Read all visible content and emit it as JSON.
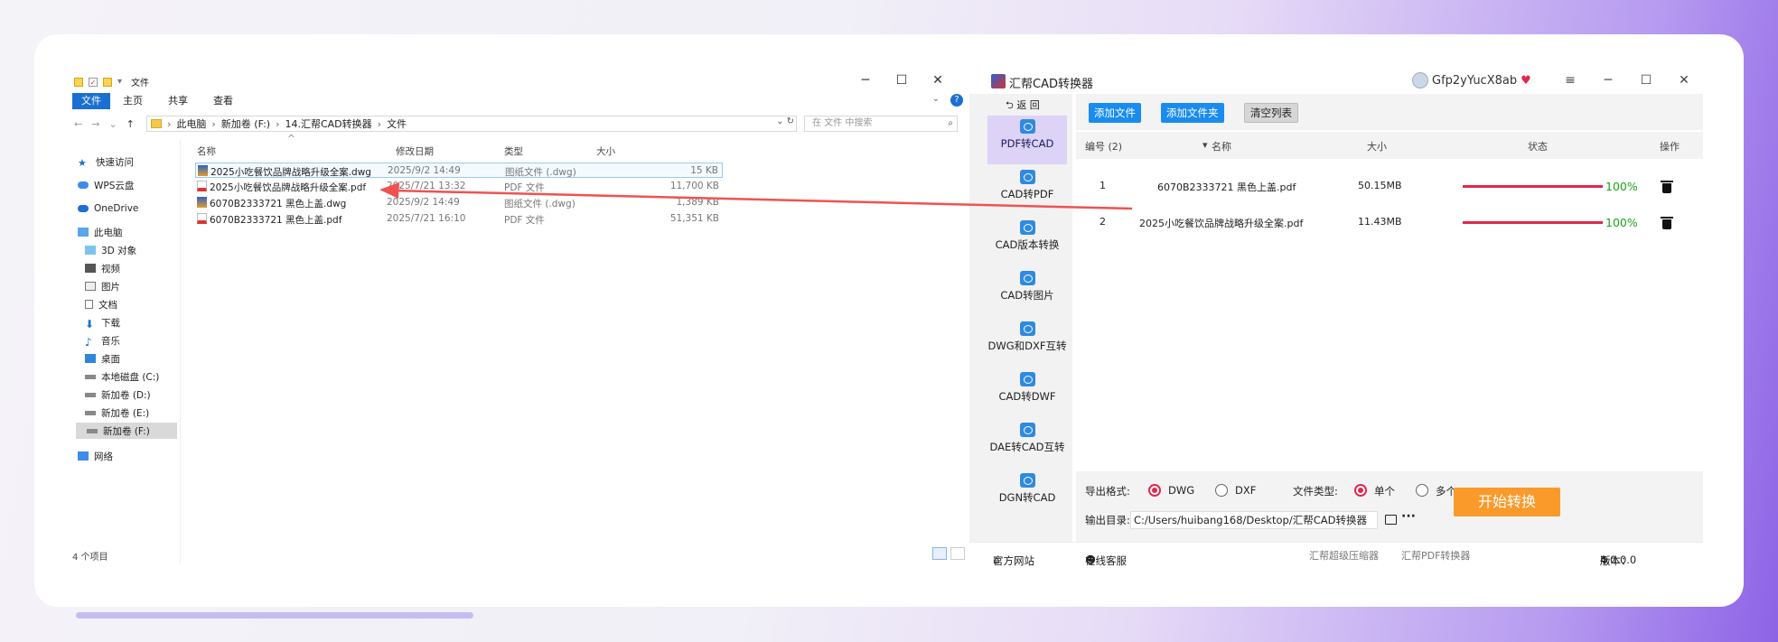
{
  "explorer": {
    "title": "文件",
    "win_min": "─",
    "win_max": "☐",
    "win_close": "✕",
    "ribbon_tabs": [
      "文件",
      "主页",
      "共享",
      "查看"
    ],
    "address": [
      "此电脑",
      "新加卷 (F:)",
      "14.汇帮CAD转换器",
      "文件"
    ],
    "search_placeholder": "在 文件 中搜索",
    "nav_items": [
      {
        "label": "快速访问",
        "icon": "star-icon"
      },
      {
        "label": "WPS云盘",
        "icon": "cloud-icon"
      },
      {
        "label": "OneDrive",
        "icon": "onedrive-icon"
      },
      {
        "label": "此电脑",
        "icon": "computer-icon"
      },
      {
        "label": "3D 对象",
        "icon": "cube-icon"
      },
      {
        "label": "视频",
        "icon": "video-icon"
      },
      {
        "label": "图片",
        "icon": "image-icon"
      },
      {
        "label": "文档",
        "icon": "document-icon"
      },
      {
        "label": "下载",
        "icon": "download-icon"
      },
      {
        "label": "音乐",
        "icon": "music-icon"
      },
      {
        "label": "桌面",
        "icon": "desktop-icon"
      },
      {
        "label": "本地磁盘 (C:)",
        "icon": "drive-icon"
      },
      {
        "label": "新加卷 (D:)",
        "icon": "drive-icon"
      },
      {
        "label": "新加卷 (E:)",
        "icon": "drive-icon"
      },
      {
        "label": "新加卷 (F:)",
        "icon": "drive-icon"
      },
      {
        "label": "网络",
        "icon": "network-icon"
      }
    ],
    "columns": [
      "名称",
      "修改日期",
      "类型",
      "大小"
    ],
    "files": [
      {
        "name": "2025小吃餐饮品牌战略升级全案.dwg",
        "date": "2025/9/2 14:49",
        "type": "图纸文件 (.dwg)",
        "size": "15 KB",
        "kind": "dwg"
      },
      {
        "name": "2025小吃餐饮品牌战略升级全案.pdf",
        "date": "2025/7/21 13:32",
        "type": "PDF 文件",
        "size": "11,700 KB",
        "kind": "pdf"
      },
      {
        "name": "6070B2333721 黑色上盖.dwg",
        "date": "2025/9/2 14:49",
        "type": "图纸文件 (.dwg)",
        "size": "1,389 KB",
        "kind": "dwg"
      },
      {
        "name": "6070B2333721 黑色上盖.pdf",
        "date": "2025/7/21 16:10",
        "type": "PDF 文件",
        "size": "51,351 KB",
        "kind": "pdf"
      }
    ],
    "status": "4 个项目"
  },
  "cad": {
    "title": "汇帮CAD转换器",
    "user": "Gfp2yYucX8ab",
    "back_label": "返 回",
    "nav": [
      "PDF转CAD",
      "CAD转PDF",
      "CAD版本转换",
      "CAD转图片",
      "DWG和DXF互转",
      "CAD转DWF",
      "DAE转CAD互转",
      "DGN转CAD"
    ],
    "toolbar": {
      "add_file": "添加文件",
      "add_folder": "添加文件夹",
      "clear_list": "清空列表"
    },
    "table_header": {
      "index": "编号 (2)",
      "name": "名称",
      "size": "大小",
      "status": "状态",
      "action": "操作"
    },
    "rows": [
      {
        "index": "1",
        "name": "6070B2333721 黑色上盖.pdf",
        "size": "50.15MB",
        "progress": 100,
        "progress_text": "100%"
      },
      {
        "index": "2",
        "name": "2025小吃餐饮品牌战略升级全案.pdf",
        "size": "11.43MB",
        "progress": 100,
        "progress_text": "100%"
      }
    ],
    "export_format_label": "导出格式:",
    "formats": [
      "DWG",
      "DXF"
    ],
    "selected_format": "DWG",
    "file_type_label": "文件类型:",
    "file_types": [
      "单个",
      "多个"
    ],
    "selected_file_type": "单个",
    "output_dir_label": "输出目录:",
    "output_dir": "C:/Users/huibang168/Desktop/汇帮CAD转换器",
    "start_button": "开始转换",
    "footer": {
      "website": "官方网站",
      "support": "在线客服",
      "compressor": "汇帮超级压缩器",
      "pdf_converter": "汇帮PDF转换器",
      "version_label": "版本：",
      "version": "4.0.0.0"
    },
    "colors": {
      "accent_blue": "#1a8cf0",
      "progress_red": "#e0284d",
      "progress_green": "#19a419",
      "start_orange": "#f99a2b",
      "nav_active": "#dcd3f6"
    }
  }
}
